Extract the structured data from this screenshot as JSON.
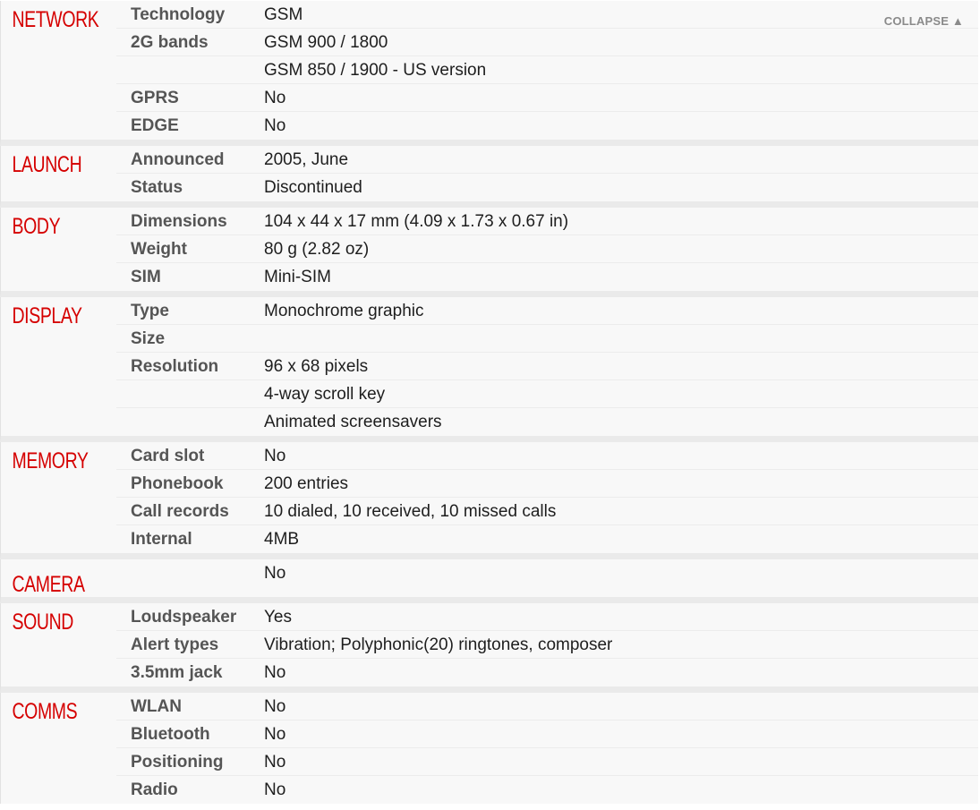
{
  "collapse_label": "COLLAPSE ▲",
  "sections": [
    {
      "key": "network",
      "title": "NETWORK",
      "rows": [
        {
          "label": "Technology",
          "value": "GSM"
        },
        {
          "label": "2G bands",
          "value": "GSM 900 / 1800"
        },
        {
          "label": "",
          "value": "GSM 850 / 1900 - US version"
        },
        {
          "label": "GPRS",
          "value": "No"
        },
        {
          "label": "EDGE",
          "value": "No"
        }
      ]
    },
    {
      "key": "launch",
      "title": "LAUNCH",
      "rows": [
        {
          "label": "Announced",
          "value": "2005, June"
        },
        {
          "label": "Status",
          "value": "Discontinued"
        }
      ]
    },
    {
      "key": "body",
      "title": "BODY",
      "rows": [
        {
          "label": "Dimensions",
          "value": "104 x 44 x 17 mm (4.09 x 1.73 x 0.67 in)"
        },
        {
          "label": "Weight",
          "value": "80 g (2.82 oz)"
        },
        {
          "label": "SIM",
          "value": "Mini-SIM"
        }
      ]
    },
    {
      "key": "display",
      "title": "DISPLAY",
      "rows": [
        {
          "label": "Type",
          "value": "Monochrome graphic"
        },
        {
          "label": "Size",
          "value": ""
        },
        {
          "label": "Resolution",
          "value": "96 x 68 pixels"
        },
        {
          "label": "",
          "value": "4-way scroll key"
        },
        {
          "label": "",
          "value": "Animated screensavers"
        }
      ]
    },
    {
      "key": "memory",
      "title": "MEMORY",
      "rows": [
        {
          "label": "Card slot",
          "value": "No"
        },
        {
          "label": "Phonebook",
          "value": "200 entries"
        },
        {
          "label": "Call records",
          "value": "10 dialed, 10 received, 10 missed calls"
        },
        {
          "label": "Internal",
          "value": "4MB"
        }
      ]
    },
    {
      "key": "camera",
      "title": "CAMERA",
      "rows": [
        {
          "label": "",
          "value": "No"
        }
      ]
    },
    {
      "key": "sound",
      "title": "SOUND",
      "rows": [
        {
          "label": "Loudspeaker",
          "value": "Yes"
        },
        {
          "label": "Alert types",
          "value": "Vibration; Polyphonic(20) ringtones, composer"
        },
        {
          "label": "3.5mm jack",
          "value": "No"
        }
      ]
    },
    {
      "key": "comms",
      "title": "COMMS",
      "rows": [
        {
          "label": "WLAN",
          "value": "No"
        },
        {
          "label": "Bluetooth",
          "value": "No"
        },
        {
          "label": "Positioning",
          "value": "No"
        },
        {
          "label": "Radio",
          "value": "No"
        }
      ]
    }
  ]
}
